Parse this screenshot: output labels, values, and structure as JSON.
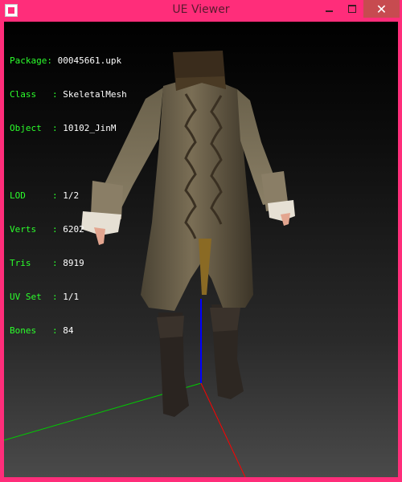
{
  "window": {
    "title": "UE Viewer"
  },
  "titlebar_buttons": {
    "minimize": "minimize",
    "maximize": "maximize",
    "close": "✕"
  },
  "info": {
    "package_label": "Package: ",
    "package_value": "00045661.upk",
    "class_label": "Class   : ",
    "class_value": "SkeletalMesh",
    "object_label": "Object  : ",
    "object_value": "10102_JinM",
    "lod_label": "LOD     : ",
    "lod_value": "1/2",
    "verts_label": "Verts   : ",
    "verts_value": "6202",
    "tris_label": "Tris    : ",
    "tris_value": "8919",
    "uvset_label": "UV Set  : ",
    "uvset_value": "1/1",
    "bones_label": "Bones   : ",
    "bones_value": "84"
  },
  "colors": {
    "titlebar": "#ff2d7a",
    "overlay_label": "#2cff2c",
    "overlay_value": "#ffffff",
    "axis_x": "#ff0000",
    "axis_y": "#00cc00",
    "axis_z": "#0000ff"
  }
}
